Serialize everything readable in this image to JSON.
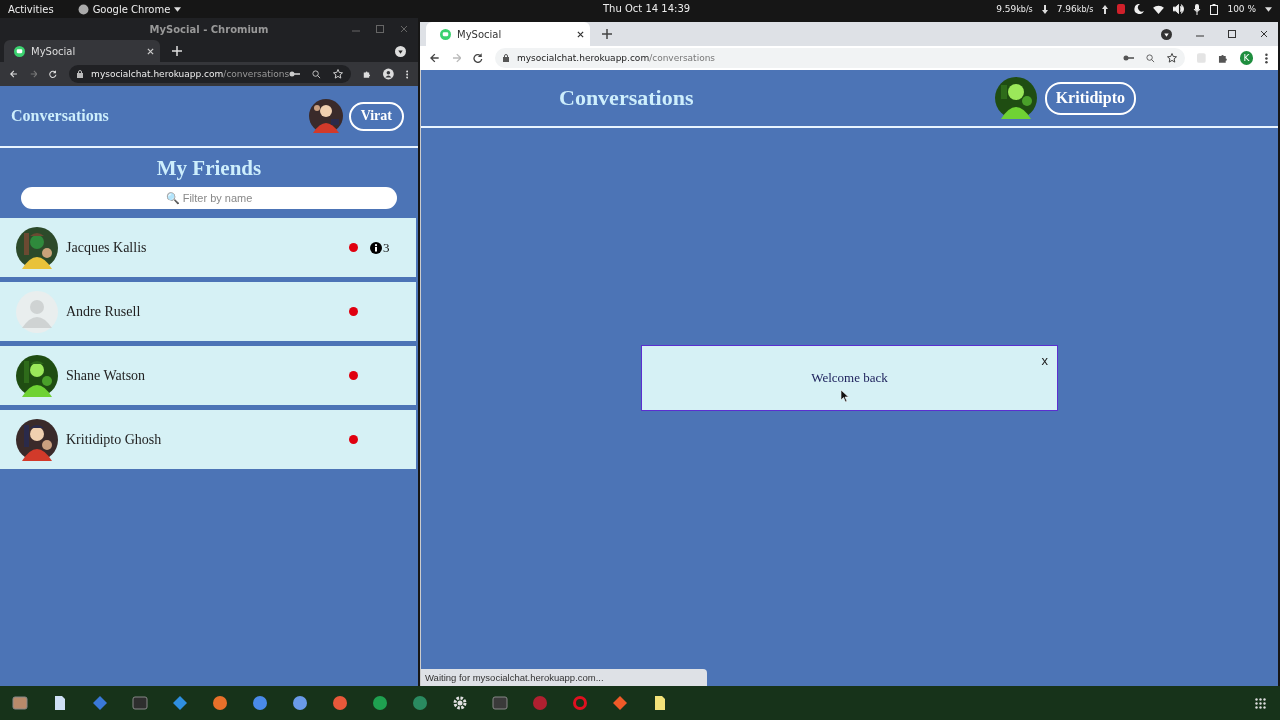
{
  "top_bar": {
    "activities": "Activities",
    "app_menu": "Google Chrome",
    "clock": "Thu Oct 14  14:39",
    "net_down": "9.59",
    "net_down_unit": "kb/s",
    "net_up": "7.96",
    "net_up_unit": "kb/s",
    "battery": "100 %"
  },
  "left_window": {
    "title": "MySocial - Chromium",
    "tab": "MySocial",
    "url_host": "mysocialchat.herokuapp.com",
    "url_path": "/conversations",
    "page": {
      "heading": "Conversations",
      "user": "Virat",
      "friends_title": "My Friends",
      "search": {
        "placeholder": "🔍 Filter by name"
      },
      "friends": [
        {
          "name": "Jacques Kallis",
          "color": "#e0000f",
          "unread": "3"
        },
        {
          "name": "Andre Rusell",
          "kind": "placeholder",
          "color": "#e0000f"
        },
        {
          "name": "Shane Watson",
          "color": "#e0000f"
        },
        {
          "name": "Kritidipto Ghosh",
          "color": "#e0000f"
        }
      ]
    }
  },
  "right_window": {
    "tab": "MySocial",
    "url_host": "mysocialchat.herokuapp.com",
    "url_path": "/conversations",
    "profile_initial": "K",
    "page": {
      "heading": "Conversations",
      "user": "Kritidipto",
      "toast": {
        "message": "Welcome back",
        "close": "x"
      }
    },
    "status": "Waiting for mysocialchat.herokuapp.com..."
  }
}
